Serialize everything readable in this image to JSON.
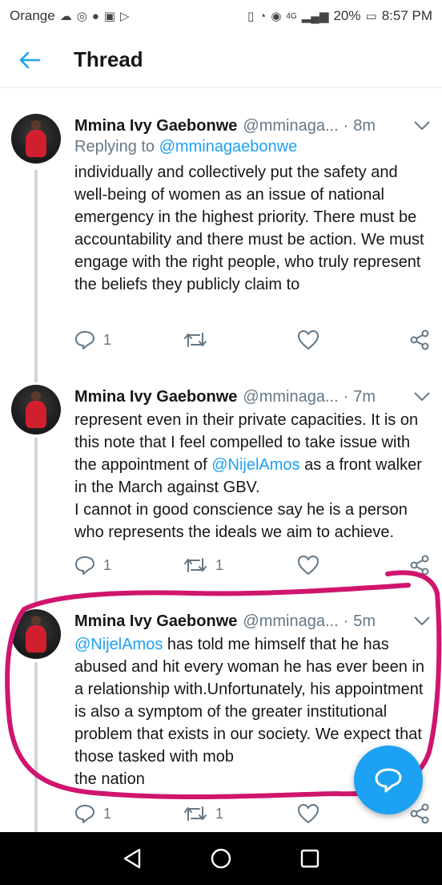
{
  "status_bar": {
    "carrier": "Orange",
    "network": "4G",
    "battery": "20%",
    "time": "8:57 PM"
  },
  "header": {
    "title": "Thread"
  },
  "tweets": [
    {
      "name": "Mmina Ivy Gaebonwe",
      "handle": "@mminaga...",
      "separator": "·",
      "time": "8m",
      "reply_prefix": "Replying to",
      "reply_to": "@mminagaebonwe",
      "text": "individually and collectively put the safety and well-being of women as an issue of national emergency in the highest priority. There must be accountability and there must be action. We must engage with the right people, who truly represent the beliefs they publicly claim to",
      "reply_count": "1",
      "retweet_count": ""
    },
    {
      "name": "Mmina Ivy Gaebonwe",
      "handle": "@mminaga...",
      "separator": "·",
      "time": "7m",
      "text_part1": "represent even in their private capacities. It is on this note that I feel compelled to take issue with the appointment of ",
      "mention": "@NijelAmos",
      "text_part2": " as a front walker in the March against GBV.",
      "text_part3": "I cannot in good conscience say he is a person who represents the ideals we aim to achieve.",
      "reply_count": "1",
      "retweet_count": "1"
    },
    {
      "name": "Mmina Ivy Gaebonwe",
      "handle": "@mminaga...",
      "separator": "·",
      "time": "5m",
      "mention": "@NijelAmos",
      "text_part1": " has told me himself that he has abused and hit every woman he has ever been in a relationship with.Unfortunately, his appointment is also a symptom of the greater institutional problem that exists in our society. We expect that those tasked with mob",
      "text_part2": "the nation",
      "reply_count": "1",
      "retweet_count": "1"
    }
  ],
  "colors": {
    "accent": "#1da1f2",
    "annotation": "#d0156e",
    "muted": "#657786"
  }
}
